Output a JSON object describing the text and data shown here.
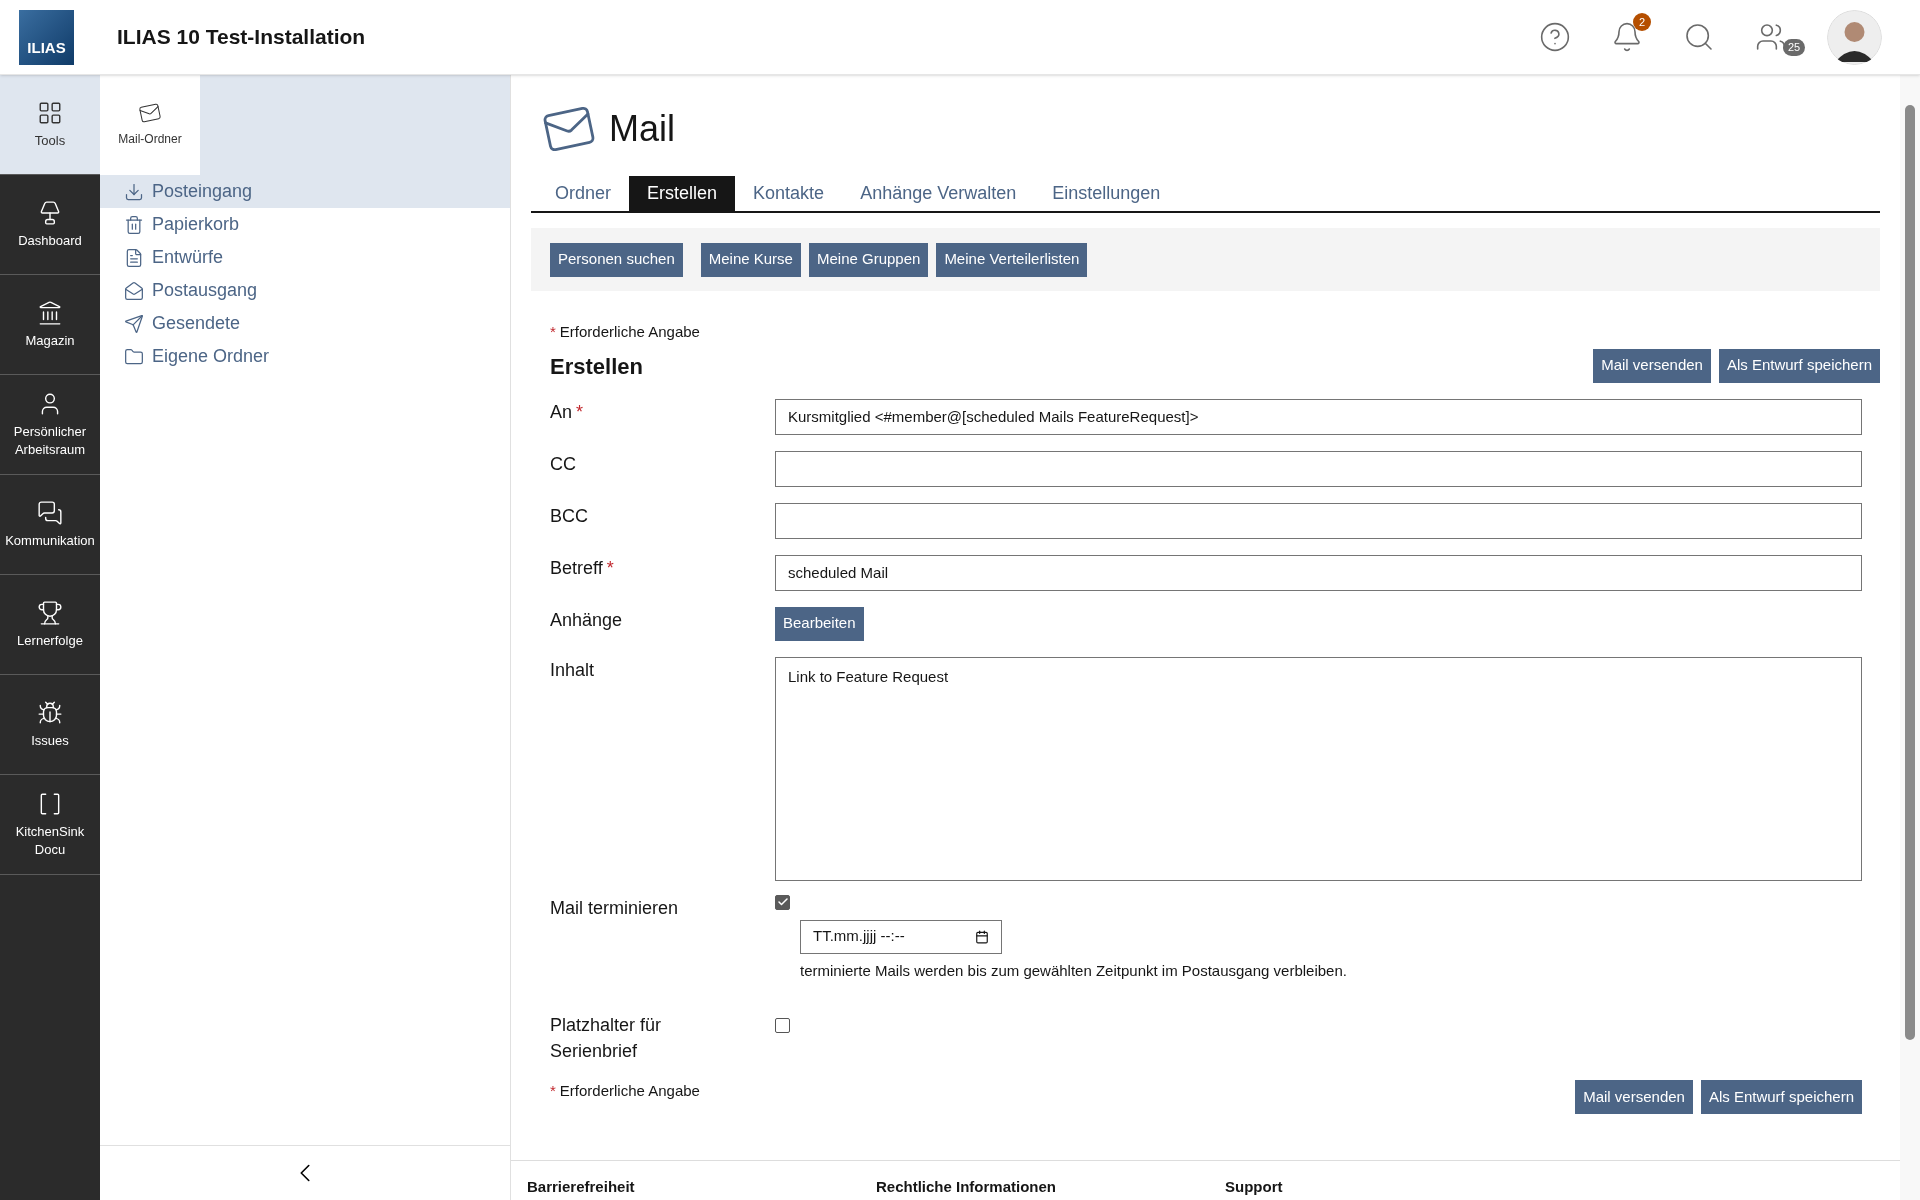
{
  "header": {
    "logo": "ILIAS",
    "title": "ILIAS 10 Test-Installation",
    "notifications_badge": "2",
    "contacts_badge": "25"
  },
  "mainbar": [
    {
      "label": "Tools",
      "selected": true
    },
    {
      "label": "Dashboard",
      "selected": false
    },
    {
      "label": "Magazin",
      "selected": false
    },
    {
      "label": "Persönlicher Arbeitsraum",
      "selected": false
    },
    {
      "label": "Kommunikation",
      "selected": false
    },
    {
      "label": "Lernerfolge",
      "selected": false
    },
    {
      "label": "Issues",
      "selected": false
    },
    {
      "label": "KitchenSink Docu",
      "selected": false
    }
  ],
  "slate": {
    "tab": "Mail-Ordner",
    "folders": [
      {
        "label": "Posteingang",
        "selected": true
      },
      {
        "label": "Papierkorb",
        "selected": false
      },
      {
        "label": "Entwürfe",
        "selected": false
      },
      {
        "label": "Postausgang",
        "selected": false
      },
      {
        "label": "Gesendete",
        "selected": false
      },
      {
        "label": "Eigene Ordner",
        "selected": false
      }
    ]
  },
  "page": {
    "title": "Mail",
    "tabs": [
      {
        "label": "Ordner",
        "selected": false
      },
      {
        "label": "Erstellen",
        "selected": true
      },
      {
        "label": "Kontakte",
        "selected": false
      },
      {
        "label": "Anhänge Verwalten",
        "selected": false
      },
      {
        "label": "Einstellungen",
        "selected": false
      }
    ],
    "toolbar": [
      "Personen suchen",
      "Meine Kurse",
      "Meine Gruppen",
      "Meine Verteilerlisten"
    ],
    "required_note": {
      "mark": "*",
      "text": "Erforderliche Angabe"
    },
    "form_title": "Erstellen",
    "actions": [
      "Mail versenden",
      "Als Entwurf speichern"
    ],
    "fields": [
      {
        "kind": "text",
        "label": "An",
        "required_mark": "*",
        "value": "Kursmitglied <#member@[scheduled Mails FeatureRequest]>"
      },
      {
        "kind": "text",
        "label": "CC"
      },
      {
        "kind": "text",
        "label": "BCC"
      },
      {
        "kind": "text",
        "label": "Betreff",
        "required_mark": "*",
        "value": "scheduled Mail"
      },
      {
        "kind": "button",
        "label": "Anhänge",
        "button": "Bearbeiten"
      },
      {
        "kind": "textarea",
        "label": "Inhalt",
        "value": "Link to Feature Request"
      },
      {
        "kind": "schedule",
        "label": "Mail terminieren",
        "checked": true,
        "placeholder": "TT.mm.jjjj --:--",
        "hint": "terminierte Mails werden bis zum gewählten Zeitpunkt im Postausgang verbleiben."
      },
      {
        "kind": "checkbox",
        "label": "Platzhalter für Serienbrief",
        "checked": false
      }
    ],
    "bottom_required_note": {
      "mark": "*",
      "text": "Erforderliche Angabe"
    },
    "bottom_actions": [
      "Mail versenden",
      "Als Entwurf speichern"
    ]
  },
  "footer": [
    "Barrierefreiheit",
    "Rechtliche Informationen",
    "Support"
  ]
}
